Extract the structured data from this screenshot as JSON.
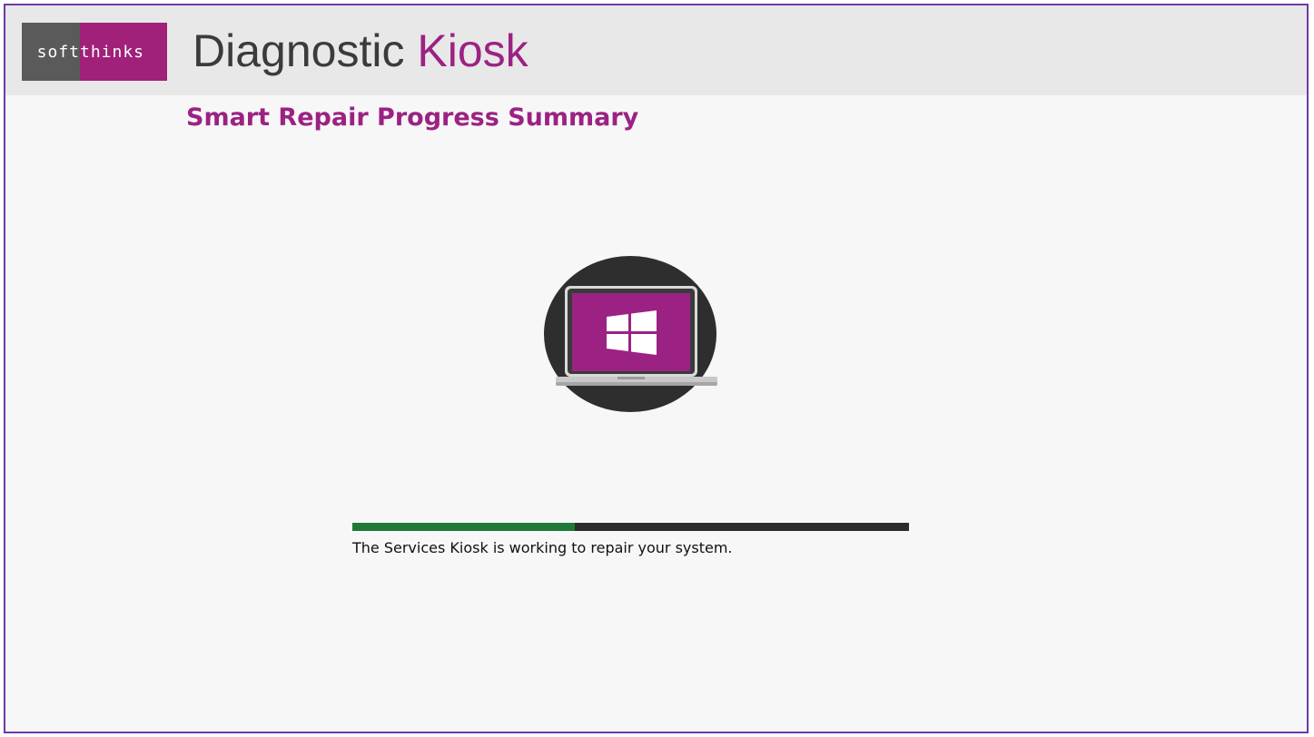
{
  "header": {
    "logo": {
      "left_text": "soft",
      "right_text": "thinks"
    },
    "title_primary": "Diagnostic",
    "title_accent": "Kiosk"
  },
  "page": {
    "title": "Smart Repair Progress Summary"
  },
  "illustration": {
    "icon": "laptop-windows-icon"
  },
  "progress": {
    "fraction": 0.4,
    "status_text": "The Services Kiosk is working to repair your system."
  },
  "colors": {
    "brand_magenta": "#9b2283",
    "logo_gray": "#5a5a5a",
    "progress_fill": "#1f7a3a",
    "progress_track": "#2c2c2c",
    "frame_border": "#6e3aa6",
    "header_bg": "#e8e8e8",
    "page_bg": "#f7f7f7"
  }
}
